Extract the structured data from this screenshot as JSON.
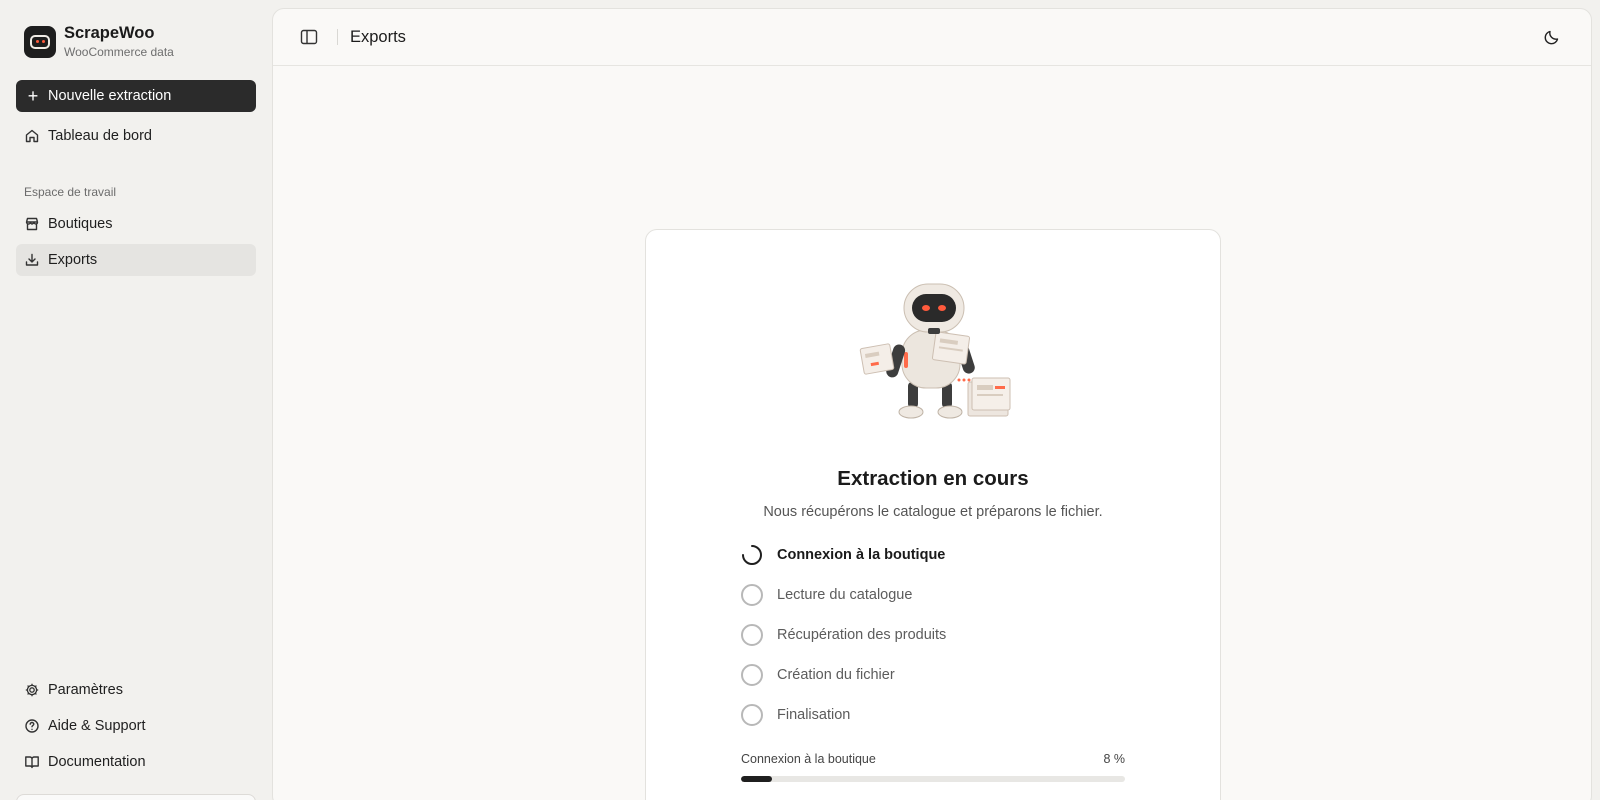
{
  "app": {
    "name": "ScrapeWoo",
    "subtitle": "WooCommerce data"
  },
  "sidebar": {
    "new_button": "Nouvelle extraction",
    "dashboard": "Tableau de bord",
    "section_label": "Espace de travail",
    "items": [
      {
        "label": "Boutiques",
        "icon": "store-icon"
      },
      {
        "label": "Exports",
        "icon": "download-icon",
        "active": true
      }
    ],
    "footer": [
      {
        "label": "Paramètres",
        "icon": "gear-icon"
      },
      {
        "label": "Aide & Support",
        "icon": "help-circle-icon"
      },
      {
        "label": "Documentation",
        "icon": "book-icon"
      }
    ]
  },
  "header": {
    "title": "Exports"
  },
  "extraction": {
    "title": "Extraction en cours",
    "subtitle": "Nous récupérons le catalogue et préparons le fichier.",
    "steps": [
      {
        "label": "Connexion à la boutique",
        "status": "in-progress"
      },
      {
        "label": "Lecture du catalogue",
        "status": "pending"
      },
      {
        "label": "Récupération des produits",
        "status": "pending"
      },
      {
        "label": "Création du fichier",
        "status": "pending"
      },
      {
        "label": "Finalisation",
        "status": "pending"
      }
    ],
    "progress": {
      "label": "Connexion à la boutique",
      "percent_text": "8 %",
      "percent": 8
    }
  },
  "colors": {
    "accent": "#2b2b2b",
    "robot_eyes": "#ff5a3c"
  }
}
